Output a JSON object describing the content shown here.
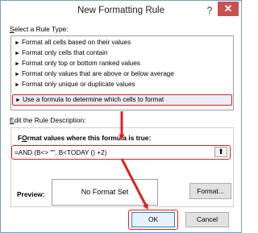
{
  "dialog": {
    "title": "New Formatting Rule",
    "help_label": "?",
    "close_label": "✕"
  },
  "rule_type": {
    "heading_prefix": "",
    "heading_key": "S",
    "heading_rest": "elect a Rule Type:",
    "items": [
      {
        "label": "Format all cells based on their values"
      },
      {
        "label": "Format only cells that contain"
      },
      {
        "label": "Format only top or bottom ranked values"
      },
      {
        "label": "Format only values that are above or below average"
      },
      {
        "label": "Format only unique or duplicate values"
      },
      {
        "label": "Use a formula to determine which cells to format"
      }
    ],
    "selected_index": 5
  },
  "description": {
    "heading_key": "E",
    "heading_rest": "dit the Rule Description:",
    "formula_label_key": "O",
    "formula_label_pre": "F",
    "formula_label_rest": "rmat values where this formula is true:",
    "formula_value": "=AND (B<> \"\", B<TODAY () +2)",
    "collapse_icon": "⬆",
    "preview_label": "Preview:",
    "preview_text": "No Format Set",
    "format_button": "Format..."
  },
  "buttons": {
    "ok": "OK",
    "cancel": "Cancel"
  },
  "colors": {
    "annotation": "#e02020",
    "close_bg": "#c75050",
    "selected_bg": "#e8eef7"
  }
}
